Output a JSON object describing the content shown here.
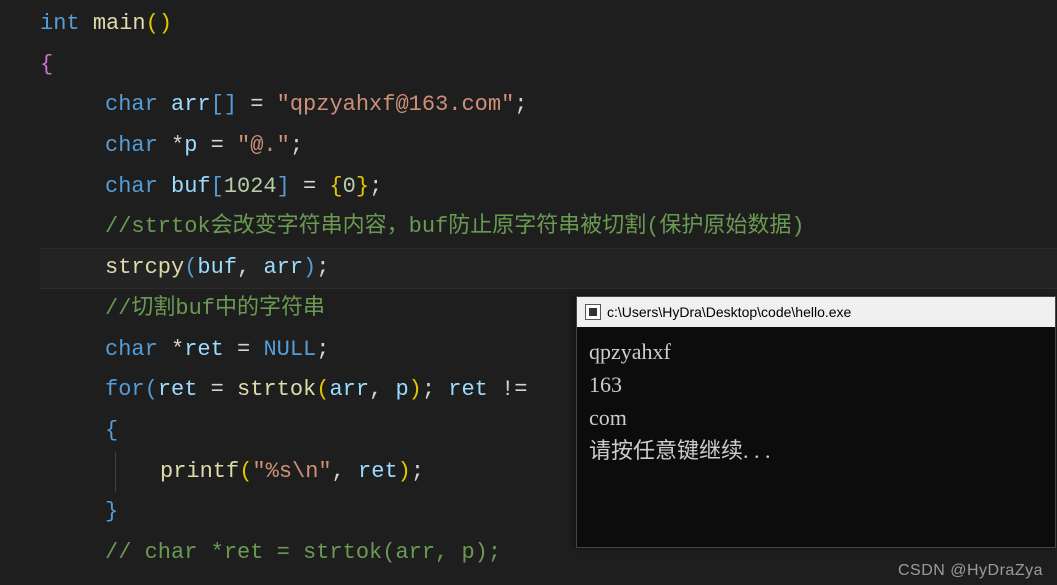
{
  "code": {
    "l1_kw1": "int",
    "l1_fn": "main",
    "l2_brace": "{",
    "l3_char": "char",
    "l3_arr": "arr",
    "l3_str": "\"qpzyahxf@163.com\"",
    "l4_char": "char",
    "l4_p": "p",
    "l4_str": "\"@.\"",
    "l5_char": "char",
    "l5_buf": "buf",
    "l5_size": "1024",
    "l5_zero": "0",
    "l6_cmt": "//strtok会改变字符串内容，buf防止原字符串被切割(保护原始数据)",
    "l7_fn": "strcpy",
    "l7_a1": "buf",
    "l7_a2": "arr",
    "l8_cmt": "//切割buf中的字符串",
    "l9_char": "char",
    "l9_ret": "ret",
    "l9_null": "NULL",
    "l10_for": "for",
    "l10_ret": "ret",
    "l10_fn": "strtok",
    "l10_arr": "arr",
    "l10_p": "p",
    "l10_ret2": "ret",
    "l10_ne": "!=",
    "l11_brace": "{",
    "l12_fn": "printf",
    "l12_fmt": "\"%s\\n\"",
    "l12_ret": "ret",
    "l13_brace": "}",
    "l14_cmt": "// char *ret = strtok(arr, p);"
  },
  "terminal": {
    "title": "c:\\Users\\HyDra\\Desktop\\code\\hello.exe",
    "lines": [
      "qpzyahxf",
      "163",
      "com",
      "请按任意键继续. . ."
    ]
  },
  "watermark": "CSDN @HyDraZya"
}
